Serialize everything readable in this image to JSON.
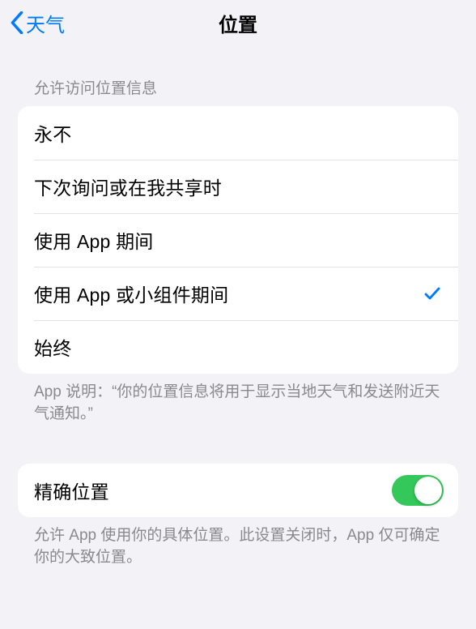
{
  "nav": {
    "back_label": "天气",
    "title": "位置"
  },
  "section1": {
    "header": "允许访问位置信息",
    "options": [
      {
        "label": "永不",
        "selected": false
      },
      {
        "label": "下次询问或在我共享时",
        "selected": false
      },
      {
        "label": "使用 App 期间",
        "selected": false
      },
      {
        "label": "使用 App 或小组件期间",
        "selected": true
      },
      {
        "label": "始终",
        "selected": false
      }
    ],
    "footer": "App 说明：“你的位置信息将用于显示当地天气和发送附近天气通知。”"
  },
  "section2": {
    "precise_label": "精确位置",
    "precise_on": true,
    "footer": "允许 App 使用你的具体位置。此设置关闭时，App 仅可确定你的大致位置。"
  }
}
